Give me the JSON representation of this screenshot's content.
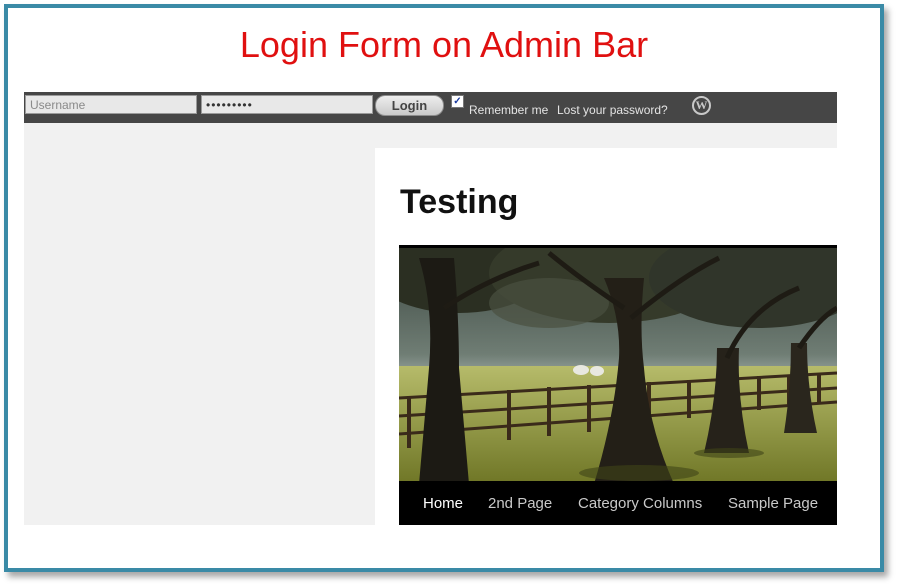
{
  "headline": "Login Form on Admin Bar",
  "admin_bar": {
    "username_placeholder": "Username",
    "password_value": "•••••••••",
    "login_label": "Login",
    "remember_checked": true,
    "remember_label": "Remember me",
    "lost_password_label": "Lost your password?",
    "logo_icon": "wordpress-icon",
    "logo_glyph": "W"
  },
  "post": {
    "title": "Testing"
  },
  "nav": {
    "items": [
      {
        "label": "Home",
        "active": true
      },
      {
        "label": "2nd Page",
        "active": false
      },
      {
        "label": "Category Columns",
        "active": false
      },
      {
        "label": "Sample Page",
        "active": false
      }
    ]
  },
  "colors": {
    "headline": "#e01010",
    "frame_border": "#3a8aa6",
    "admin_bar_bg": "#464646",
    "nav_bg": "#000000"
  }
}
